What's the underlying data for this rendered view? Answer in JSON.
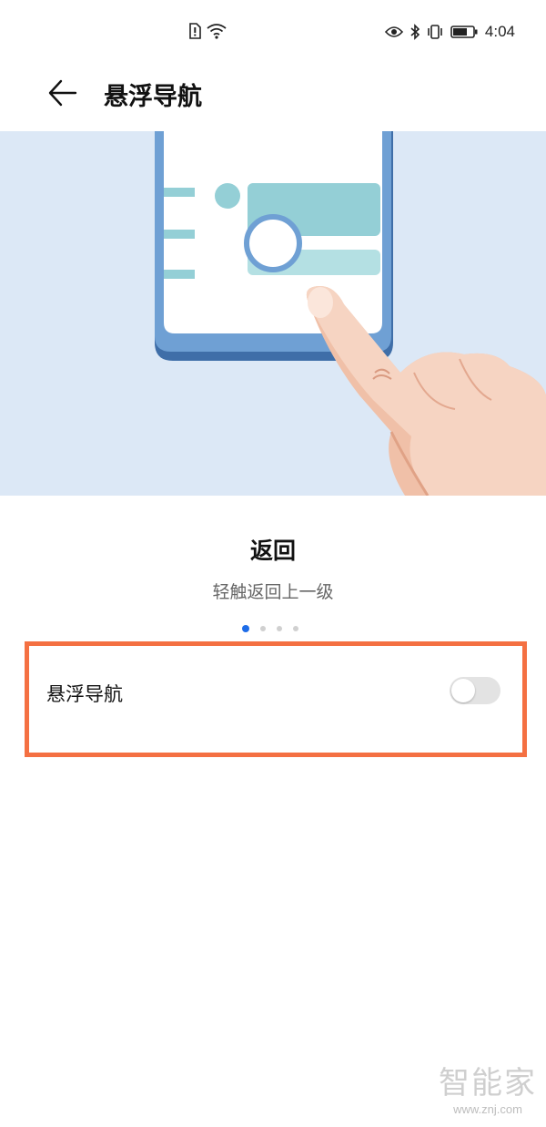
{
  "status_bar": {
    "time": "4:04",
    "left_icons": [
      "sim-alert-icon",
      "wifi-icon"
    ],
    "right_icons": [
      "eye-comfort-icon",
      "bluetooth-icon",
      "vibrate-icon",
      "battery-icon"
    ]
  },
  "header": {
    "back_icon": "arrow-left-icon",
    "title": "悬浮导航"
  },
  "tutorial": {
    "title": "返回",
    "description": "轻触返回上一级",
    "pages": 4,
    "current_page": 1
  },
  "setting": {
    "label": "悬浮导航",
    "enabled": false
  },
  "watermark": {
    "logo": "智能家",
    "url": "www.znj.com"
  },
  "colors": {
    "illustration_bg": "#dce8f6",
    "phone_frame": "#6fa0d4",
    "accent": "#1e6ce8",
    "highlight_border": "#f47042",
    "card": "#94cfd6"
  }
}
